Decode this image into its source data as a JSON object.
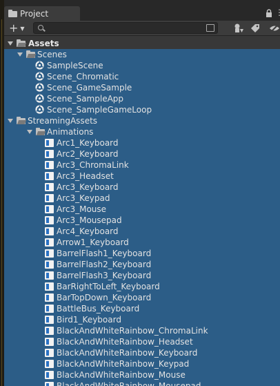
{
  "window": {
    "tab_label": "Project"
  },
  "toolbar": {
    "add_label": "+",
    "search_value": ""
  },
  "tree": {
    "assets_label": "Assets",
    "scenes_label": "Scenes",
    "scenes": [
      "SampleScene",
      "Scene_Chromatic",
      "Scene_GameSample",
      "Scene_SampleApp",
      "Scene_SampleGameLoop"
    ],
    "streaming_label": "StreamingAssets",
    "animations_label": "Animations",
    "animations": [
      "Arc1_Keyboard",
      "Arc2_Keyboard",
      "Arc3_ChromaLink",
      "Arc3_Headset",
      "Arc3_Keyboard",
      "Arc3_Keypad",
      "Arc3_Mouse",
      "Arc3_Mousepad",
      "Arc4_Keyboard",
      "Arrow1_Keyboard",
      "BarrelFlash1_Keyboard",
      "BarrelFlash2_Keyboard",
      "BarrelFlash3_Keyboard",
      "BarRightToLeft_Keyboard",
      "BarTopDown_Keyboard",
      "BattleBus_Keyboard",
      "Bird1_Keyboard",
      "BlackAndWhiteRainbow_ChromaLink",
      "BlackAndWhiteRainbow_Headset",
      "BlackAndWhiteRainbow_Keyboard",
      "BlackAndWhiteRainbow_Keypad",
      "BlackAndWhiteRainbow_Mouse",
      "BlackAndWhiteRainbow_Mousepad"
    ]
  },
  "colors": {
    "selection": "#2c5d87",
    "panel": "#383838",
    "text": "#e2e2e2"
  }
}
